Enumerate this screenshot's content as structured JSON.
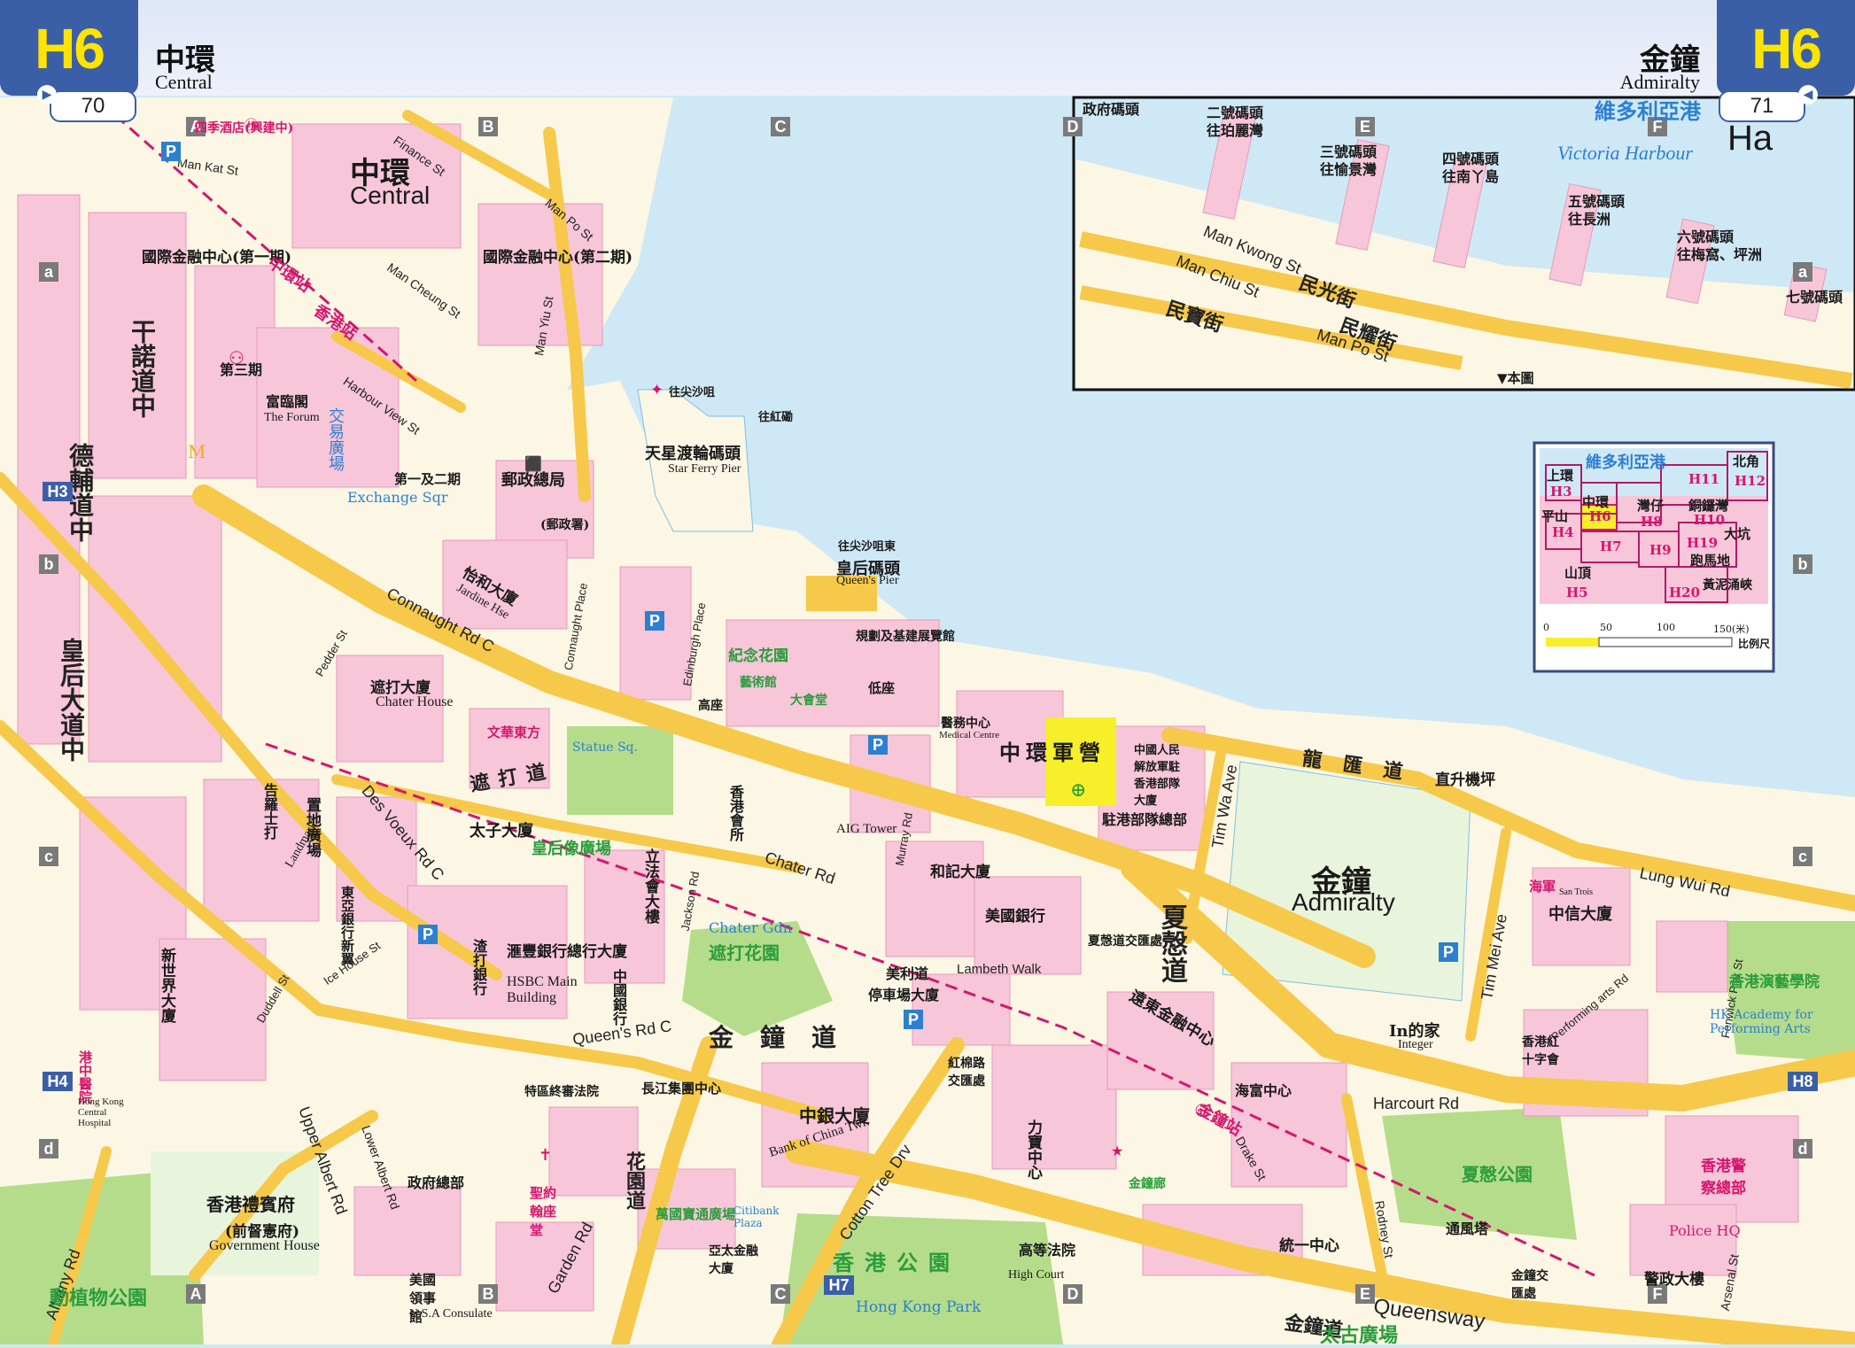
{
  "header": {
    "left_grid": "H6",
    "left_page": "70",
    "left_zh": "中環",
    "left_en": "Central",
    "right_grid": "H6",
    "right_page": "71",
    "right_zh": "金鐘",
    "right_en": "Admiralty"
  },
  "grid_letters": [
    "A",
    "B",
    "C",
    "D",
    "E",
    "F"
  ],
  "grid_rows": [
    "a",
    "b",
    "c",
    "d"
  ],
  "districts": {
    "central_zh": "中環",
    "central_en": "Central",
    "admiralty_zh": "金鐘",
    "admiralty_en": "Admiralty"
  },
  "harbour": {
    "zh": "維多利亞港",
    "en": "Victoria Harbour",
    "inset_label": "Ha"
  },
  "piers": [
    "政府碼頭",
    "二號碼頭",
    "往珀麗灣",
    "三號碼頭",
    "往愉景灣",
    "四號碼頭",
    "往南丫島",
    "五號碼頭",
    "往長洲",
    "六號碼頭",
    "往梅窩、坪洲",
    "七號碼頭"
  ],
  "inset_roads": {
    "man_kwong": "Man Kwong St",
    "man_chiu": "Man Chiu St",
    "man_kwong_zh": "民光街",
    "man_po_zh": "民寶街",
    "man_yiu_zh": "民耀街",
    "man_po_en": "Man Po St",
    "ifc": "▼本圖"
  },
  "roads": {
    "connaught": "Connaught Rd C",
    "chater": "Chater Rd",
    "queens": "Queen's Rd C",
    "desvoeux": "Des Voeux Rd C",
    "harcourt": "Harcourt Rd",
    "lungwui": "Lung Wui Rd",
    "cottontree": "Cotton Tree Drv",
    "gardenrd": "Garden Rd",
    "queensway": "Queensway",
    "timwa": "Tim Wa Ave",
    "timmei": "Tim Mei Ave",
    "albany": "Albany Rd",
    "upperalbert": "Upper Albert Rd",
    "lower_albert": "Lower Albert Rd",
    "manyiu": "Man Yiu St",
    "finance": "Finance St",
    "harbourview": "Harbour View St",
    "mankat": "Man Kat St",
    "mancheung": "Man Cheung St",
    "mans_po": "Man Po St",
    "lambeth": "Lambeth Walk",
    "drake": "Drake St",
    "rodney": "Rodney St",
    "arsenal": "Arsenal St",
    "fenwick": "Fenwick Pier St",
    "performingarts": "Performing arts Rd",
    "edinburgh": "Edinburgh Place",
    "connaughtplace": "Connaught Place",
    "jackson": "Jackson Rd",
    "murray": "Murray Rd",
    "icehouse": "Ice House St",
    "duddell": "Duddell St",
    "pedder": "Pedder St",
    "zh_gan_nok": "干諾道中",
    "zh_del_fu": "德輔道中",
    "zh_queens": "皇后大道中",
    "zh_harcourt": "夏慤道",
    "zh_kam_chung": "金鐘道",
    "zh_lung_wui": "龍匯道",
    "zh_chater": "遮打道",
    "zh_garden": "花園道",
    "zh_queensway": "金鐘道"
  },
  "landmarks": [
    {
      "zh": "國際金融中心(第一期)"
    },
    {
      "zh": "國際金融中心(第二期)"
    },
    {
      "zh": "四季酒店(興建中)"
    },
    {
      "zh": "第三期"
    },
    {
      "zh": "富臨閣",
      "en": "The Forum"
    },
    {
      "zh": "交易廣場",
      "en": "Exchange Sqr"
    },
    {
      "zh": "第一及二期"
    },
    {
      "zh": "郵政總局",
      "note": "(郵政署)"
    },
    {
      "zh": "天星渡輪碼頭",
      "en": "Star Ferry Pier"
    },
    {
      "zh": "往尖沙咀"
    },
    {
      "zh": "往紅磡"
    },
    {
      "zh": "皇后碼頭",
      "en": "Queen's Pier"
    },
    {
      "zh": "往尖沙咀東"
    },
    {
      "zh": "怡和大廈",
      "en": "Jardine Hse"
    },
    {
      "zh": "遮打大廈",
      "en": "Chater House"
    },
    {
      "zh": "文華東方"
    },
    {
      "zh": "太子大廈"
    },
    {
      "zh": "皇后像廣場",
      "en": "Statue Sq."
    },
    {
      "zh": "紀念花園"
    },
    {
      "zh": "藝術館"
    },
    {
      "zh": "大會堂"
    },
    {
      "zh": "規劃及基建展覽館"
    },
    {
      "zh": "低座"
    },
    {
      "zh": "高座"
    },
    {
      "zh": "立法會大樓"
    },
    {
      "zh": "香港會所"
    },
    {
      "zh": "AIG Tower"
    },
    {
      "zh": "遮打花園",
      "en": "Chater Gdn"
    },
    {
      "zh": "中環軍營"
    },
    {
      "zh": "醫務中心",
      "en": "Medical Centre"
    },
    {
      "zh": "中國人民解放軍駐香港部隊大廈"
    },
    {
      "zh": "駐港部隊總部"
    },
    {
      "zh": "直升機坪"
    },
    {
      "zh": "置地廣場",
      "en": "Landmark"
    },
    {
      "zh": "東亞銀行新翼"
    },
    {
      "zh": "渣打銀行"
    },
    {
      "zh": "滙豐銀行總行大廈",
      "en": "HSBC Main Building"
    },
    {
      "zh": "中國銀行"
    },
    {
      "zh": "美利道"
    },
    {
      "zh": "停車場大廈"
    },
    {
      "zh": "長江集團中心"
    },
    {
      "zh": "中銀大廈",
      "en": "Bank of China Twr."
    },
    {
      "zh": "和記大廈"
    },
    {
      "zh": "美國銀行"
    },
    {
      "zh": "夏愨道交匯處"
    },
    {
      "zh": "遠東金融中心"
    },
    {
      "zh": "海富中心"
    },
    {
      "zh": "力寶中心"
    },
    {
      "zh": "統一中心"
    },
    {
      "zh": "金鐘廊"
    },
    {
      "zh": "太古廣場"
    },
    {
      "zh": "高等法院",
      "en": "High Court"
    },
    {
      "zh": "香港公園",
      "en": "Hong Kong Park"
    },
    {
      "zh": "香港禮賓府",
      "note": "(前督憲府)",
      "en": "Government House"
    },
    {
      "zh": "政府總部"
    },
    {
      "zh": "美國領事館",
      "en": "U.S.A Consulate"
    },
    {
      "zh": "動植物公園"
    },
    {
      "zh": "中信大廈"
    },
    {
      "zh": "海軍",
      "en": "San Trois"
    },
    {
      "zh": "香港紅十字會"
    },
    {
      "zh": "香港演藝學院",
      "en": "HK Academy for Performing Arts"
    },
    {
      "zh": "香港警察總部",
      "en": "Police HQ"
    },
    {
      "zh": "警政大樓"
    },
    {
      "zh": "夏慤公園"
    },
    {
      "zh": "通風塔"
    },
    {
      "zh": "In的家",
      "en": "Integer"
    },
    {
      "zh": "港中醫院",
      "en": "Hong Kong Central Hospital"
    },
    {
      "zh": "萬國寶通廣場",
      "en": "Citibank Plaza"
    },
    {
      "zh": "亞太金融大廈"
    },
    {
      "zh": "聖約翰座堂"
    },
    {
      "zh": "特區終審法院"
    },
    {
      "zh": "紅棉路交匯處"
    },
    {
      "zh": "金鐘交匯處"
    },
    {
      "zh": "新世界大廈"
    },
    {
      "zh": "告羅士打"
    },
    {
      "zh": "大會堂"
    }
  ],
  "stations": [
    {
      "zh": "中環站"
    },
    {
      "zh": "香港站"
    },
    {
      "zh": "金鐘站"
    }
  ],
  "key_map": {
    "title": "維多利亞港",
    "cells": [
      "上環",
      "H3",
      "中環",
      "H6",
      "灣仔",
      "H8",
      "銅鑼灣",
      "H10",
      "H11",
      "北角",
      "H12",
      "平山",
      "H4",
      "H7",
      "H9",
      "H19",
      "大坑",
      "跑馬地",
      "山頂",
      "H5",
      "H20",
      "黃泥涌峽"
    ],
    "scale_ticks": [
      "0",
      "50",
      "100",
      "150(米)"
    ],
    "scale_label": "比例尺"
  },
  "neighbour_refs": [
    "H3",
    "H4",
    "H7",
    "H8"
  ],
  "colors": {
    "water": "#cfe8f5",
    "land": "#fbf7e4",
    "building": "#f7c6d9",
    "road": "#f6c94a",
    "park": "#b5dc8b",
    "accent": "#3b5fa6",
    "mtr": "#d6156e",
    "military": "#f7ef2a"
  },
  "icons": [
    "parking-icon",
    "mtr-station-icon",
    "bus-stop-icon",
    "hotel-icon",
    "police-icon",
    "church-icon",
    "post-office-icon",
    "ferry-pier-icon",
    "mcdonalds-icon",
    "helipad-icon"
  ]
}
